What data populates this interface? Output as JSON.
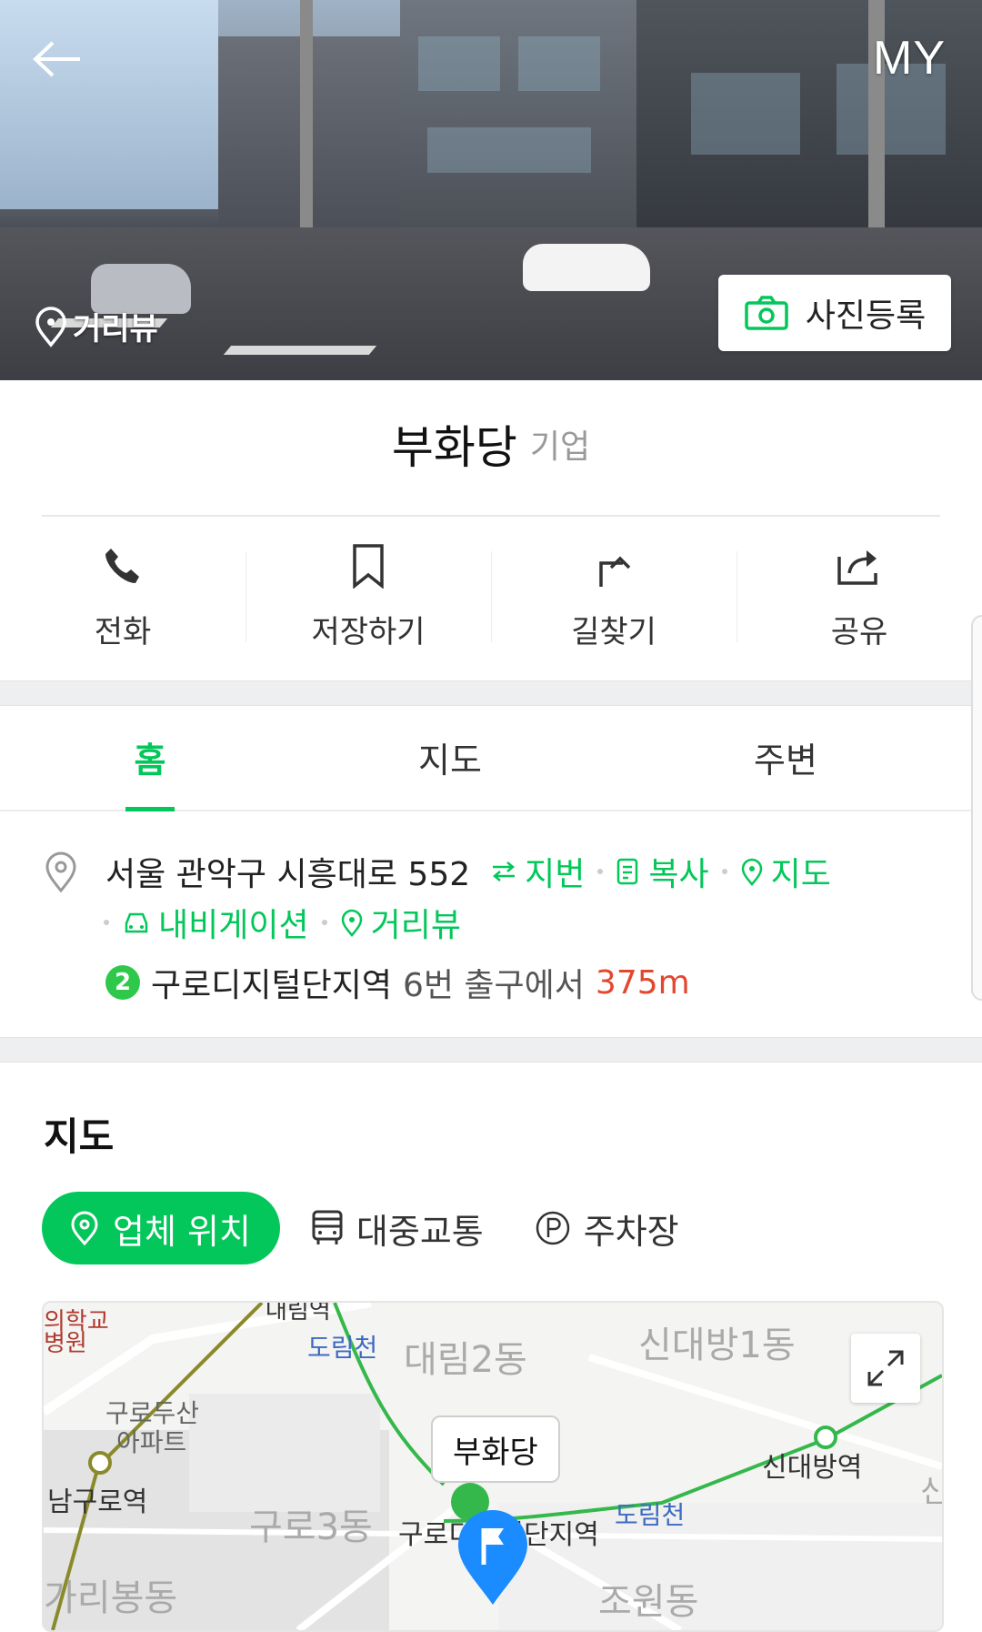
{
  "header": {
    "back_icon": "arrow-left-icon",
    "my_label": "MY",
    "streetview_label": "거리뷰",
    "photo_button_label": "사진등록"
  },
  "place": {
    "name": "부화당",
    "category": "기업"
  },
  "actions": [
    {
      "label": "전화",
      "icon": "phone-icon"
    },
    {
      "label": "저장하기",
      "icon": "bookmark-icon"
    },
    {
      "label": "길찾기",
      "icon": "directions-icon"
    },
    {
      "label": "공유",
      "icon": "share-icon"
    }
  ],
  "tabs": [
    {
      "label": "홈",
      "active": true
    },
    {
      "label": "지도",
      "active": false
    },
    {
      "label": "주변",
      "active": false
    }
  ],
  "info": {
    "address": "서울 관악구 시흥대로 552",
    "lot_number_link": "지번",
    "copy_link": "복사",
    "map_link": "지도",
    "navigation_link": "내비게이션",
    "streetview_link": "거리뷰",
    "subway_line": "2",
    "subway_line_color": "#2ec94a",
    "station": "구로디지털단지역",
    "exit_text": "6번 출구에서",
    "distance": "375m",
    "accent_color": "#03c75a",
    "distance_color": "#e2472f"
  },
  "map_section": {
    "title": "지도",
    "tabs": [
      {
        "label": "업체 위치",
        "active": true
      },
      {
        "label": "대중교통",
        "active": false
      },
      {
        "label": "주차장",
        "active": false
      }
    ],
    "marker_label": "부화당",
    "labels": {
      "top_left_1": "의학교",
      "top_left_2": "병원",
      "top_station": "대림역",
      "dorimcheon_1": "도림천",
      "daerim2": "대림2동",
      "sindaebang1": "신대방1동",
      "guro_dusan_1": "구로두산",
      "guro_dusan_2": "아파트",
      "namguro": "남구로역",
      "sindaebang_station": "신대방역",
      "dorimcheon_2": "도림천",
      "guro3": "구로3동",
      "guro_digital": "구로디지털단지역",
      "garibong": "가리봉동",
      "jowon": "조원동",
      "edge_char": "신"
    }
  }
}
